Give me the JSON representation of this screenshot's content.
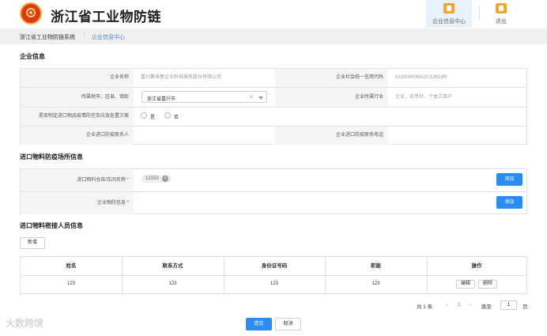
{
  "header": {
    "app_title": "浙江省工业物防链",
    "nav": [
      {
        "label": "企业信息中心",
        "icon": "enterprise-icon"
      },
      {
        "label": "退出",
        "icon": "logout-icon"
      }
    ]
  },
  "breadcrumb": {
    "items": [
      "浙江省工业物防链系统",
      "企业信息中心"
    ],
    "separator": "/"
  },
  "enterprise_info": {
    "title": "企业信息",
    "company_name_label": "企业名称",
    "company_name_value": "嘉兴聚来屋企业科技服务股份有限公司",
    "credit_code_label": "企业社会统一信用代码",
    "credit_code_value": "91330400MA2CX3KL8R",
    "region_label": "所属地市、区县、镇街",
    "region_value": "浙江省嘉兴市",
    "industry_label": "企业所属行业",
    "industry_value": "企业、农专社、个体工商户",
    "plan_label": "是否制定进口物品疫情防控及应急处置方案",
    "plan_yes": "是",
    "plan_no": "否",
    "contact_label": "企业进口防疫联系人",
    "contact_value": "",
    "phone_label": "企业进口防疫联系电话",
    "phone_value": ""
  },
  "sites_info": {
    "title": "进口物料防疫场所信息",
    "warehouse_label": "进口物料仓库/车间名称",
    "warehouse_tag": "12333",
    "site_label": "企业物防信息",
    "required_mark": "*",
    "add_label": "添加"
  },
  "personnel": {
    "title": "进口物料密接人员信息",
    "new_button": "新增",
    "columns": [
      "姓名",
      "联系方式",
      "身份证号码",
      "职能",
      "操作"
    ],
    "rows": [
      {
        "name": "123",
        "contact": "123",
        "id_number": "123",
        "role": "123"
      }
    ],
    "edit_label": "编辑",
    "delete_label": "删除"
  },
  "pagination": {
    "total": "共 1 条",
    "prev": "‹",
    "current": "1",
    "next": "›",
    "jump_to": "跳至",
    "page_input": "1",
    "page_suffix": "页"
  },
  "footer": {
    "submit": "提交",
    "cancel": "取消"
  },
  "watermark": "大数跨境",
  "colors": {
    "primary": "#2d8cf0",
    "accent_link": "#3f86d8",
    "logo_red": "#d83a1e",
    "nav_icon": "#f2a533"
  }
}
